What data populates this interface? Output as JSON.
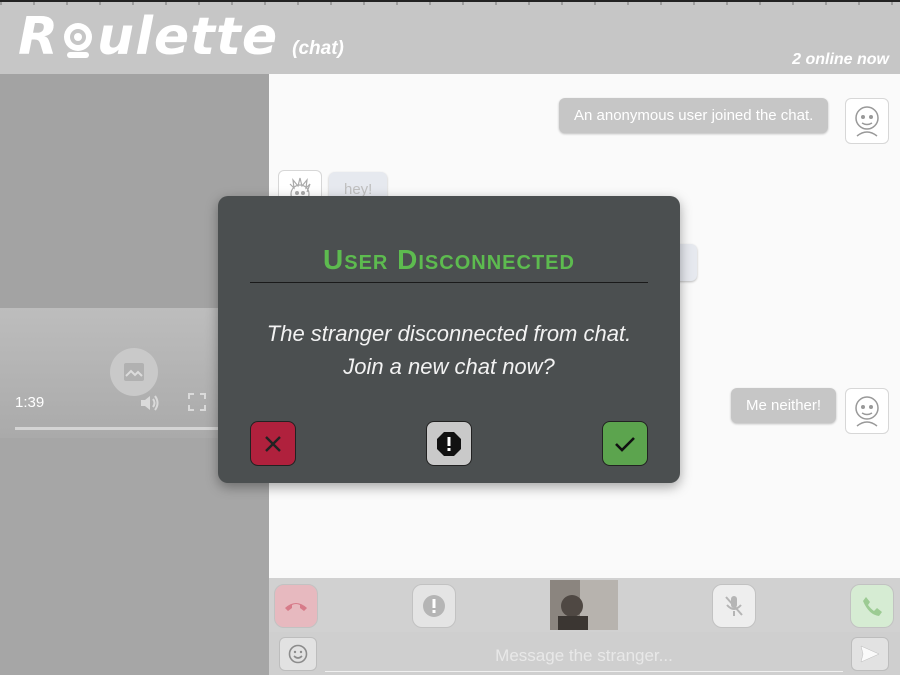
{
  "header": {
    "logo_text_before": "R",
    "logo_text_after": "ulette",
    "logo_sub": "(chat)",
    "online_status": "2 online now"
  },
  "video": {
    "time": "1:39",
    "icons": [
      "image-placeholder-icon",
      "volume-icon",
      "fullscreen-icon"
    ]
  },
  "chat": {
    "messages": [
      {
        "side": "mine",
        "text": "An anonymous user joined the chat."
      },
      {
        "side": "theirs",
        "text": "hey!"
      },
      {
        "side": "mine",
        "text": "Me neither!"
      }
    ]
  },
  "controls": {
    "icons": [
      "hang-up-icon",
      "report-icon",
      "self-video-preview",
      "mute-mic-icon",
      "call-icon"
    ]
  },
  "composer": {
    "placeholder": "Message the stranger...",
    "value": ""
  },
  "modal": {
    "title": "User Disconnected",
    "line1": "The stranger disconnected from chat.",
    "line2": "Join a new chat now?",
    "buttons": [
      "decline-button",
      "report-button",
      "accept-button"
    ]
  },
  "colors": {
    "title_green": "#5dbb4f",
    "decline_red": "#b0213d",
    "accept_green": "#5ca44e",
    "modal_bg": "#4b4f50"
  }
}
